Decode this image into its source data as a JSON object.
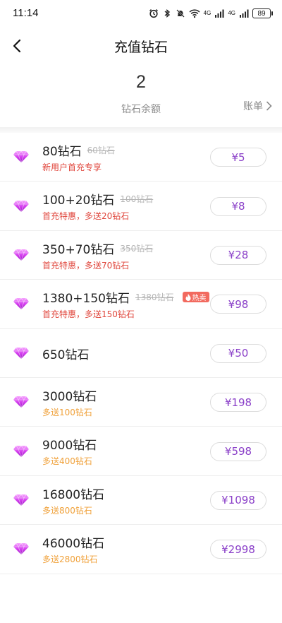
{
  "status_bar": {
    "time": "11:14",
    "network_label_1": "4G",
    "network_label_2": "4G",
    "battery": "89",
    "icons": [
      "alarm-icon",
      "bluetooth-icon",
      "mute-bell-icon",
      "wifi-icon",
      "signal-icon",
      "signal-icon",
      "battery-icon"
    ]
  },
  "nav": {
    "title": "充值钻石",
    "back_icon": "chevron-left-icon"
  },
  "balance": {
    "value": "2",
    "label": "钻石余额",
    "bill_link": "账单",
    "bill_icon": "chevron-right-icon"
  },
  "colors": {
    "price_text": "#8a3fc8",
    "promo_red": "#e0463c",
    "promo_orange": "#f0a13a",
    "hot_badge": "#f26a5f",
    "gem_gradient": [
      "#f07dff",
      "#b21ed6"
    ]
  },
  "packages": [
    {
      "amount": "80钻石",
      "original": "60钻石",
      "promo": "新用户首充专享",
      "promo_style": "red",
      "price": "¥5",
      "hot": false
    },
    {
      "amount": "100+20钻石",
      "original": "100钻石",
      "promo": "首充特惠，多送20钻石",
      "promo_style": "red",
      "price": "¥8",
      "hot": false
    },
    {
      "amount": "350+70钻石",
      "original": "350钻石",
      "promo": "首充特惠，多送70钻石",
      "promo_style": "red",
      "price": "¥28",
      "hot": false
    },
    {
      "amount": "1380+150钻石",
      "original": "1380钻石",
      "promo": "首充特惠，多送150钻石",
      "promo_style": "red",
      "price": "¥98",
      "hot": true,
      "hot_label": "热卖"
    },
    {
      "amount": "650钻石",
      "original": "",
      "promo": "",
      "promo_style": "",
      "price": "¥50",
      "hot": false
    },
    {
      "amount": "3000钻石",
      "original": "",
      "promo": "多送100钻石",
      "promo_style": "orange",
      "price": "¥198",
      "hot": false
    },
    {
      "amount": "9000钻石",
      "original": "",
      "promo": "多送400钻石",
      "promo_style": "orange",
      "price": "¥598",
      "hot": false
    },
    {
      "amount": "16800钻石",
      "original": "",
      "promo": "多送800钻石",
      "promo_style": "orange",
      "price": "¥1098",
      "hot": false
    },
    {
      "amount": "46000钻石",
      "original": "",
      "promo": "多送2800钻石",
      "promo_style": "orange",
      "price": "¥2998",
      "hot": false
    }
  ]
}
